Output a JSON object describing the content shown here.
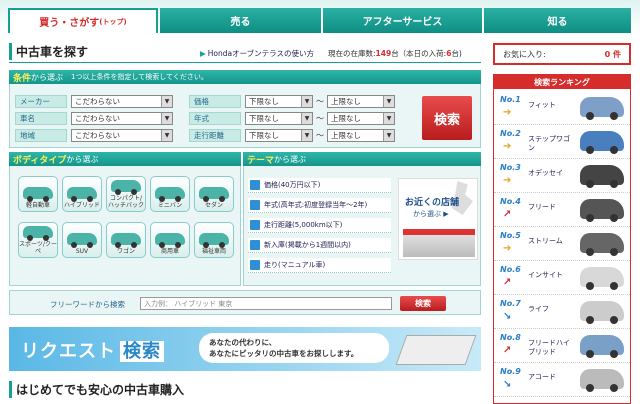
{
  "tabs": [
    {
      "label": "買う・さがす",
      "small": "(トップ)"
    },
    {
      "label": "売る"
    },
    {
      "label": "アフターサービス"
    },
    {
      "label": "知る"
    }
  ],
  "page_title": "中古車を探す",
  "help_link": "Hondaオーブンテラスの使い方",
  "stock": {
    "prefix": "現在の在庫数:",
    "count": "149",
    "unit": "台（本日の入荷:",
    "today": "6",
    "suffix": "台)"
  },
  "favorites": {
    "label": "お気に入り:",
    "count": "0 件"
  },
  "conditions": {
    "head": "条件",
    "head_suffix": "から選ぶ",
    "note": "1つ以上条件を指定して検索してください。",
    "rows": [
      {
        "label": "メーカー",
        "value": "こだわらない",
        "label2": "価格",
        "min": "下限なし",
        "max": "上限なし"
      },
      {
        "label": "車名",
        "value": "こだわらない",
        "label2": "年式",
        "min": "下限なし",
        "max": "上限なし"
      },
      {
        "label": "地域",
        "value": "こだわらない",
        "label2": "走行距離",
        "min": "下限なし",
        "max": "上限なし"
      }
    ],
    "tilde": "〜",
    "search": "検索"
  },
  "body": {
    "head": "ボディタイプ",
    "head_suffix": "から選ぶ",
    "items": [
      "軽自動車",
      "ハイブリッド",
      "コンパクト/ハッチバック",
      "ミニバン",
      "セダン",
      "スポーツ/クーペ",
      "SUV",
      "ワゴン",
      "商用車",
      "福祉車両"
    ]
  },
  "theme": {
    "head": "テーマ",
    "head_suffix": "から選ぶ",
    "items": [
      "価格(40万円以下)",
      "年式(高年式:初度登録当年〜2年)",
      "走行距離(5,000km以下)",
      "新入庫(掲載から1週間以内)",
      "走り(マニュアル車)"
    ]
  },
  "store": {
    "title": "お近くの店舗",
    "sub": "から選ぶ ▶"
  },
  "freeword": {
    "label": "フリーワードから検索",
    "placeholder": "入力例： ハイブリッド 東京",
    "button": "検索"
  },
  "banner": {
    "title": "リクエスト",
    "title2": "検索",
    "line1": "あなたの代わりに、",
    "line2": "あなたにピッタリの中古車をお探しします。"
  },
  "sub_title": "はじめてでも安心の中古車購入",
  "ranking": {
    "head": "検索ランキング",
    "items": [
      {
        "no": "No.1",
        "name": "フィット",
        "arrow": "➔",
        "arrow_color": "#e8a21c",
        "color": "#7ea0c8"
      },
      {
        "no": "No.2",
        "name": "ステップワゴン",
        "arrow": "➔",
        "arrow_color": "#e8a21c",
        "color": "#4a7fbf"
      },
      {
        "no": "No.3",
        "name": "オデッセイ",
        "arrow": "➔",
        "arrow_color": "#e8a21c",
        "color": "#444"
      },
      {
        "no": "No.4",
        "name": "フリード",
        "arrow": "↗",
        "arrow_color": "#d62c2c",
        "color": "#555"
      },
      {
        "no": "No.5",
        "name": "ストリーム",
        "arrow": "➔",
        "arrow_color": "#e8a21c",
        "color": "#666"
      },
      {
        "no": "No.6",
        "name": "インサイト",
        "arrow": "↗",
        "arrow_color": "#d62c2c",
        "color": "#d8d8d8"
      },
      {
        "no": "No.7",
        "name": "ライフ",
        "arrow": "↘",
        "arrow_color": "#2a7fc8",
        "color": "#ccc"
      },
      {
        "no": "No.8",
        "name": "フリードハイブリッド",
        "arrow": "↗",
        "arrow_color": "#d62c2c",
        "color": "#7aa0c8"
      },
      {
        "no": "No.9",
        "name": "アコード",
        "arrow": "↘",
        "arrow_color": "#2a7fc8",
        "color": "#bbb"
      }
    ]
  }
}
